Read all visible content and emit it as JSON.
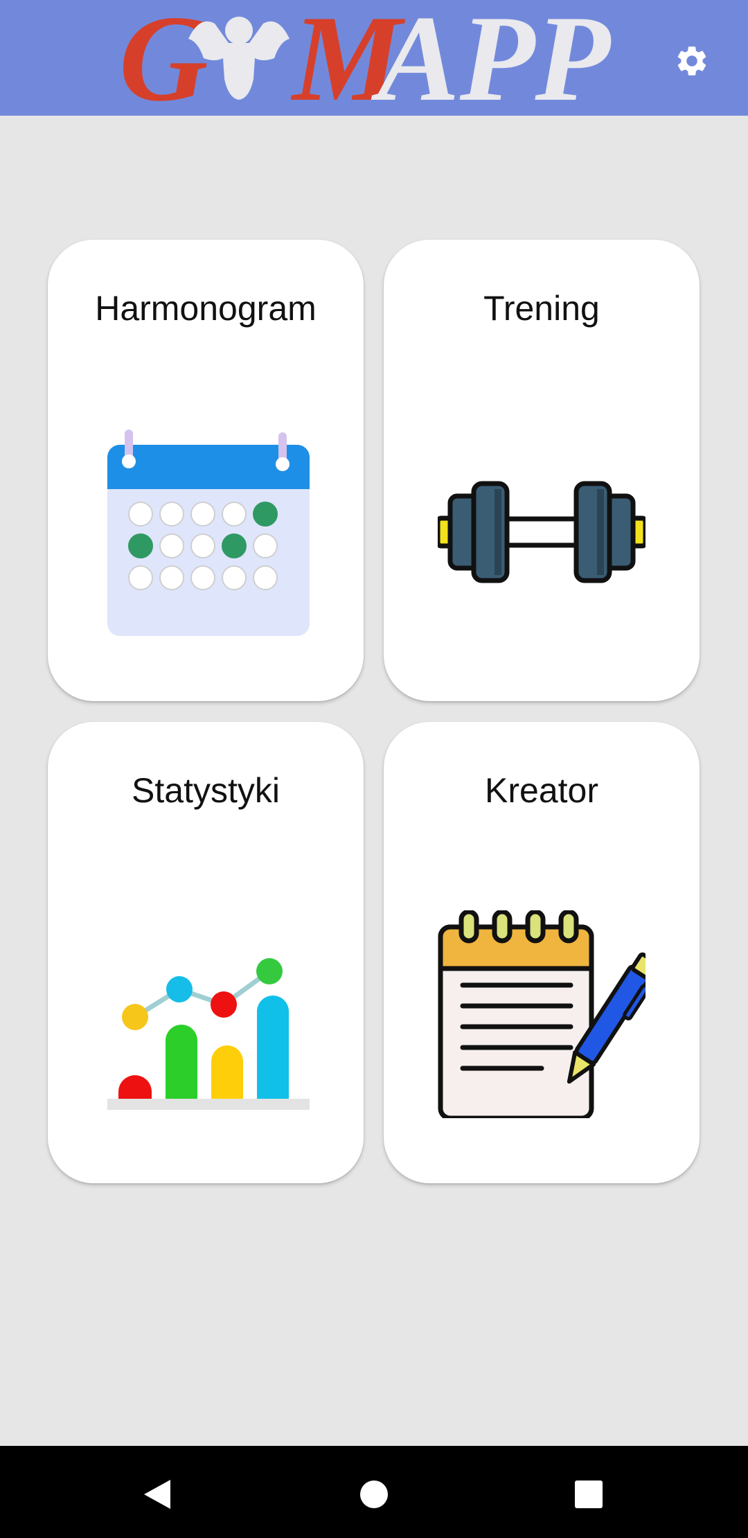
{
  "app": {
    "logo_text_red": "G",
    "logo_text_red2": "M",
    "logo_text_white": "APP",
    "logo_red_color": "#d6402b",
    "logo_white_color": "#e9e9ee",
    "logo_icon": "bodybuilder-icon"
  },
  "header": {
    "background": "#7289db",
    "settings_icon": "gear-icon"
  },
  "tiles": [
    {
      "label": "Harmonogram",
      "icon": "calendar-icon"
    },
    {
      "label": "Trening",
      "icon": "dumbbell-icon"
    },
    {
      "label": "Statystyki",
      "icon": "chart-icon"
    },
    {
      "label": "Kreator",
      "icon": "notepad-pen-icon"
    }
  ],
  "navigation": {
    "back_icon": "back-triangle-icon",
    "home_icon": "home-circle-icon",
    "recents_icon": "recents-square-icon"
  }
}
